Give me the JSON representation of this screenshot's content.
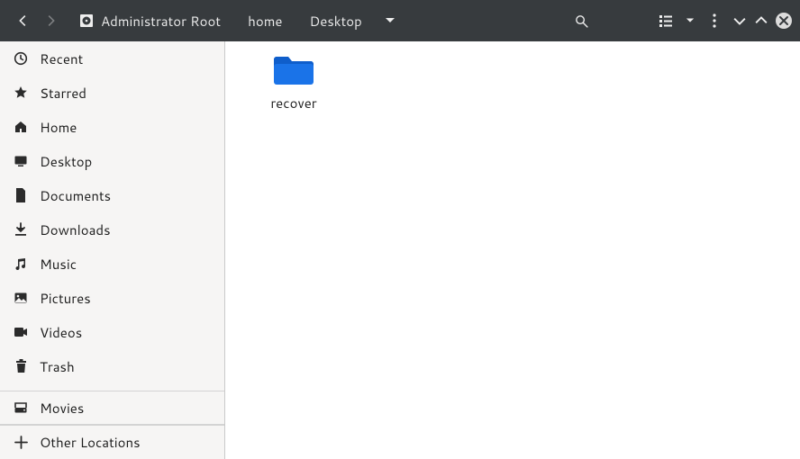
{
  "breadcrumbs": {
    "seg0": "Administrator Root",
    "seg1": "home",
    "seg2": "Desktop"
  },
  "sidebar": {
    "items": {
      "recent": "Recent",
      "starred": "Starred",
      "home": "Home",
      "desktop": "Desktop",
      "documents": "Documents",
      "downloads": "Downloads",
      "music": "Music",
      "pictures": "Pictures",
      "videos": "Videos",
      "trash": "Trash",
      "movies": "Movies",
      "other": "Other Locations"
    }
  },
  "content": {
    "items": {
      "0": {
        "name": "recover",
        "kind": "folder",
        "color": "#1a73e8"
      }
    }
  },
  "icons": {
    "back": "back-icon",
    "forward": "forward-icon",
    "admin_disk": "disk-icon",
    "path_menu": "chevron-down-icon",
    "search": "search-icon",
    "view_list": "view-list-icon",
    "view_menu": "chevron-down-icon",
    "overflow": "overflow-menu-icon",
    "minimize": "chevron-down-icon",
    "maximize": "chevron-up-icon",
    "close": "close-icon"
  }
}
